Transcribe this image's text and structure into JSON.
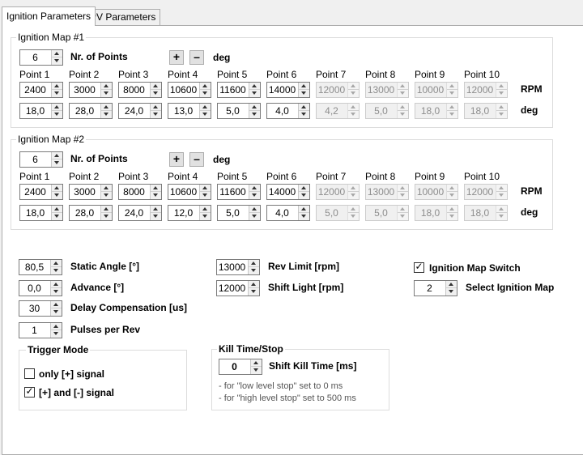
{
  "tabs": [
    {
      "label": "Ignition Parameters",
      "active": true
    },
    {
      "label": "PV Parameters",
      "active": false
    }
  ],
  "map1": {
    "title": "Ignition Map #1",
    "nr_points_value": "6",
    "nr_points_label": "Nr. of Points",
    "plus_label": "+",
    "minus_label": "–",
    "deg_label": "deg",
    "point_labels": [
      "Point 1",
      "Point 2",
      "Point 3",
      "Point 4",
      "Point 5",
      "Point 6",
      "Point 7",
      "Point 8",
      "Point 9",
      "Point 10"
    ],
    "rpm": [
      "2400",
      "3000",
      "8000",
      "10600",
      "11600",
      "14000",
      "12000",
      "13000",
      "10000",
      "12000"
    ],
    "deg": [
      "18,0",
      "28,0",
      "24,0",
      "13,0",
      "5,0",
      "4,0",
      "4,2",
      "5,0",
      "18,0",
      "18,0"
    ],
    "rpm_unit": "RPM",
    "deg_unit": "deg",
    "enabled_points": 6
  },
  "map2": {
    "title": "Ignition Map #2",
    "nr_points_value": "6",
    "nr_points_label": "Nr. of Points",
    "plus_label": "+",
    "minus_label": "–",
    "deg_label": "deg",
    "point_labels": [
      "Point 1",
      "Point 2",
      "Point 3",
      "Point 4",
      "Point 5",
      "Point 6",
      "Point 7",
      "Point 8",
      "Point 9",
      "Point 10"
    ],
    "rpm": [
      "2400",
      "3000",
      "8000",
      "10600",
      "11600",
      "14000",
      "12000",
      "13000",
      "10000",
      "12000"
    ],
    "deg": [
      "18,0",
      "28,0",
      "24,0",
      "12,0",
      "5,0",
      "4,0",
      "5,0",
      "5,0",
      "18,0",
      "18,0"
    ],
    "rpm_unit": "RPM",
    "deg_unit": "deg",
    "enabled_points": 6
  },
  "settings": {
    "static_angle": {
      "value": "80,5",
      "label": "Static Angle [°]"
    },
    "advance": {
      "value": "0,0",
      "label": "Advance [°]"
    },
    "delay_comp": {
      "value": "30",
      "label": "Delay Compensation [us]"
    },
    "pulses": {
      "value": "1",
      "label": "Pulses per Rev"
    },
    "rev_limit": {
      "value": "13000",
      "label": "Rev Limit [rpm]"
    },
    "shift_light": {
      "value": "12000",
      "label": "Shift Light [rpm]"
    },
    "map_switch": {
      "label": "Ignition Map Switch",
      "checked": true
    },
    "select_map": {
      "value": "2",
      "label": "Select Ignition Map"
    }
  },
  "trigger": {
    "title": "Trigger Mode",
    "only_plus": {
      "label": "only [+] signal",
      "checked": false
    },
    "plus_minus": {
      "label": "[+] and [-] signal",
      "checked": true
    }
  },
  "kill": {
    "title": "Kill Time/Stop",
    "value": "0",
    "label": "Shift Kill Time [ms]",
    "note1": "- for \"low level stop\" set to 0 ms",
    "note2": "- for \"high level stop\" set to 500 ms"
  },
  "colors": {
    "border": "#7a7a7a",
    "disabled_text": "#8d8d8d",
    "tab_border": "#adadad"
  }
}
